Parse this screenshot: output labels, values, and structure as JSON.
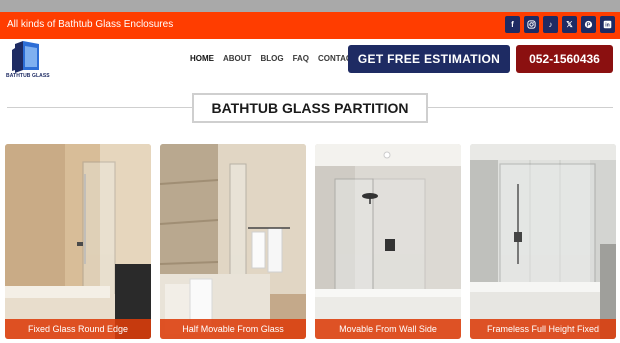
{
  "topbar": {
    "tagline": "All kinds of Bathtub Glass Enclosures",
    "socials": [
      {
        "name": "facebook-icon",
        "glyph": "f"
      },
      {
        "name": "instagram-icon",
        "glyph": ""
      },
      {
        "name": "tiktok-icon",
        "glyph": "♪"
      },
      {
        "name": "x-icon",
        "glyph": "𝕏"
      },
      {
        "name": "pinterest-icon",
        "glyph": "P"
      },
      {
        "name": "linkedin-icon",
        "glyph": "in"
      }
    ]
  },
  "logo": {
    "text": "BATHTUB GLASS"
  },
  "nav": [
    "HOME",
    "ABOUT",
    "BLOG",
    "FAQ",
    "CONTACT"
  ],
  "cta": {
    "estimate": "GET FREE ESTIMATION",
    "phone": "052-1560436"
  },
  "section": {
    "title": "BATHTUB GLASS PARTITION"
  },
  "cards": [
    {
      "caption": "Fixed Glass Round Edge"
    },
    {
      "caption": "Half Movable From Glass"
    },
    {
      "caption": "Movable From Wall Side"
    },
    {
      "caption": "Frameless Full Height Fixed"
    }
  ],
  "colors": {
    "topbar": "#ff3d00",
    "navy": "#1e2b63",
    "maroon": "#8b1010",
    "caption": "#dc3c0a"
  }
}
